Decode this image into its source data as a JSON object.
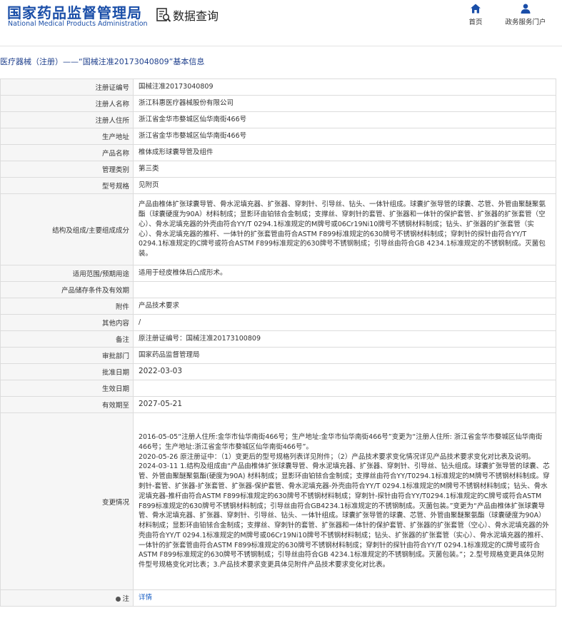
{
  "header": {
    "logo_cn": "国家药品监督管理局",
    "logo_en": "National Medical Products Administration",
    "query_title": "数据查询",
    "nav": {
      "home": "首页",
      "gov_service": "政务服务门户"
    },
    "brand_color": "#1a4ea8"
  },
  "breadcrumb": "医疗器械（注册）——“国械注准20173040809”基本信息",
  "rows": {
    "reg_no": {
      "label": "注册证编号",
      "value": "国械注准20173040809"
    },
    "registrant": {
      "label": "注册人名称",
      "value": "浙江科惠医疗器械股份有限公司"
    },
    "registrant_addr": {
      "label": "注册人住所",
      "value": "浙江省金华市婺城区仙华南街466号"
    },
    "production_addr": {
      "label": "生产地址",
      "value": "浙江省金华市婺城区仙华南街466号"
    },
    "product_name": {
      "label": "产品名称",
      "value": "椎体成形球囊导管及组件"
    },
    "mgmt_class": {
      "label": "管理类别",
      "value": "第三类"
    },
    "model_spec": {
      "label": "型号规格",
      "value": "见附页"
    },
    "structure": {
      "label": "结构及组成/主要组成成分",
      "value": "产品由椎体扩张球囊导管、骨水泥填充器、扩张器、穿刺针、引导丝、钻头、一体针组成。球囊扩张导管的球囊、芯管、外管由聚醚聚氨酯（球囊硬度为90A）材料制成；显影环由铂铱合金制成；支撑丝、穿刺针的套管、扩张器和一体针的保护套管、扩张器的扩张套管（空心）、骨水泥填充器的外壳由符合YY/T 0294.1标准规定的M牌号或06Cr19Ni10牌号不锈钢材料制成；钻头、扩张器的扩张套管（实心）、骨水泥填充器的推杆、一体针的扩张套管由符合ASTM F899标准规定的630牌号不锈钢材料制成；穿刺针的探针由符合YY/T 0294.1标准规定的C牌号或符合ASTM F899标准规定的630牌号不锈钢制成；引导丝由符合GB 4234.1标准规定的不锈钢制成。灭菌包装。"
    },
    "scope": {
      "label": "适用范围/预期用途",
      "value": "适用于经皮椎体后凸成形术。"
    },
    "storage": {
      "label": "产品储存条件及有效期",
      "value": ""
    },
    "attachment": {
      "label": "附件",
      "value": "产品技术要求"
    },
    "other": {
      "label": "其他内容",
      "value": "/"
    },
    "remark": {
      "label": "备注",
      "value": "原注册证编号：国械注准20173100809"
    },
    "approval_dept": {
      "label": "审批部门",
      "value": "国家药品监督管理局"
    },
    "approval_date": {
      "label": "批准日期",
      "value": "2022-03-03"
    },
    "effective_date": {
      "label": "生效日期",
      "value": ""
    },
    "valid_until": {
      "label": "有效期至",
      "value": "2027-05-21"
    },
    "change": {
      "label": "变更情况",
      "p1": "2016-05-05“注册人住所:金华市仙华南街466号；生产地址:金华市仙华南街466号”变更为“注册人住所: 浙江省金华市婺城区仙华南街466号；生产地址:浙江省金华市婺城区仙华南街466号”。",
      "p2": "2020-05-26 原注册证中：（1）变更后的型号规格列表详见附件；（2）产品技术要求变化情况详见产品技术要求变化对比表及说明。",
      "p3": "2024-03-11 1.结构及组成由“产品由椎体扩张球囊导管、骨水泥填充器、扩张器、穿刺针、引导丝、钻头组成。球囊扩张导管的球囊、芯管、外管由聚醚聚氨酯(硬度为90A) 材料制成；显影环由铂铱合金制成；支撑丝由符合YY/T0294.1标准规定的M牌号不锈钢材料制成。穿刺针-套管、扩张器-扩张套管、扩张器-保护套管、骨水泥填充器-外壳由符合YY/T 0294.1标准规定的M牌号不锈钢材料制成；钻头、骨水泥填充器-推杆由符合ASTM F899标准规定的630牌号不锈钢材料制成；穿刺针-探针由符合YY/T0294.1标准规定的C牌号或符合ASTM F899标准规定的630牌号不锈钢材料制成；引导丝由符合GB4234.1标准规定的不锈钢制成。灭菌包装。”变更为“产品由椎体扩张球囊导管、骨水泥填充器、扩张器、穿刺针、引导丝、钻头、一体针组成。球囊扩张导管的球囊、芯管、外管由聚醚聚氨酯（球囊硬度为90A）材料制成；显影环由铂铱合金制成；支撑丝、穿刺针的套管、扩张器和一体针的保护套管、扩张器的扩张套管（空心）、骨水泥填充器的外壳由符合YY/T 0294.1标准规定的M牌号或06Cr19Ni10牌号不锈钢材料制成；钻头、扩张器的扩张套管（实心）、骨水泥填充器的推杆、一体针的扩张套管由符合ASTM F899标准规定的630牌号不锈钢材料制成；穿刺针的探针由符合YY/T 0294.1标准规定的C牌号或符合ASTM F899标准规定的630牌号不锈钢制成；引导丝由符合GB 4234.1标准规定的不锈钢制成。灭菌包装。”；2.型号规格变更具体见附件型号规格变化对比表；3.产品技术要求变更具体见附件产品技术要求变化对比表。"
    },
    "note": {
      "label": "注",
      "value": "详情"
    }
  }
}
